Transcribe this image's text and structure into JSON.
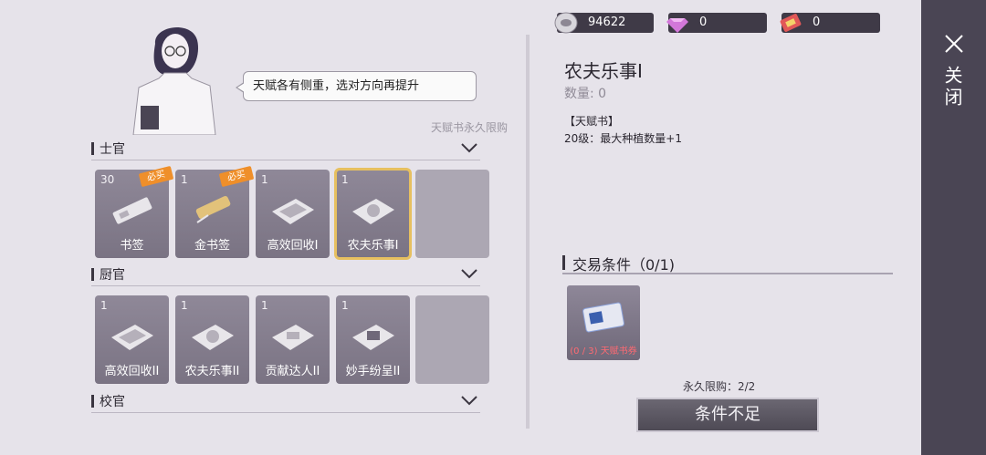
{
  "npc": {
    "speech": "天赋各有侧重，选对方向再提升"
  },
  "shop_note": "天赋书永久限购",
  "sections": [
    {
      "title": "士官",
      "items": [
        {
          "qty": "30",
          "name": "书签",
          "badge": "必买"
        },
        {
          "qty": "1",
          "name": "金书签",
          "badge": "必买"
        },
        {
          "qty": "1",
          "name": "高效回收I",
          "badge": ""
        },
        {
          "qty": "1",
          "name": "农夫乐事I",
          "badge": ""
        }
      ]
    },
    {
      "title": "厨官",
      "items": [
        {
          "qty": "1",
          "name": "高效回收II",
          "badge": ""
        },
        {
          "qty": "1",
          "name": "农夫乐事II",
          "badge": ""
        },
        {
          "qty": "1",
          "name": "贡献达人II",
          "badge": ""
        },
        {
          "qty": "1",
          "name": "妙手纷呈II",
          "badge": ""
        }
      ]
    },
    {
      "title": "校官",
      "items": []
    }
  ],
  "currencies": [
    {
      "icon": "coin-icon",
      "value": "94622"
    },
    {
      "icon": "gem-icon",
      "value": "0"
    },
    {
      "icon": "ticket-icon",
      "value": "0"
    }
  ],
  "detail": {
    "title": "农夫乐事I",
    "quantity": "数量: 0",
    "category": "【天赋书】",
    "effect": "20级：最大种植数量+1"
  },
  "trade": {
    "title": "交易条件（0/1)",
    "requirement_label": "(0 / 3) 天赋书券",
    "limit": "永久限购：2/2",
    "button": "条件不足"
  },
  "close_label": "关闭",
  "colors": {
    "selected_outline": "#e7c060",
    "badge": "#ef8f2a",
    "requirement_red": "#ff6a72"
  }
}
